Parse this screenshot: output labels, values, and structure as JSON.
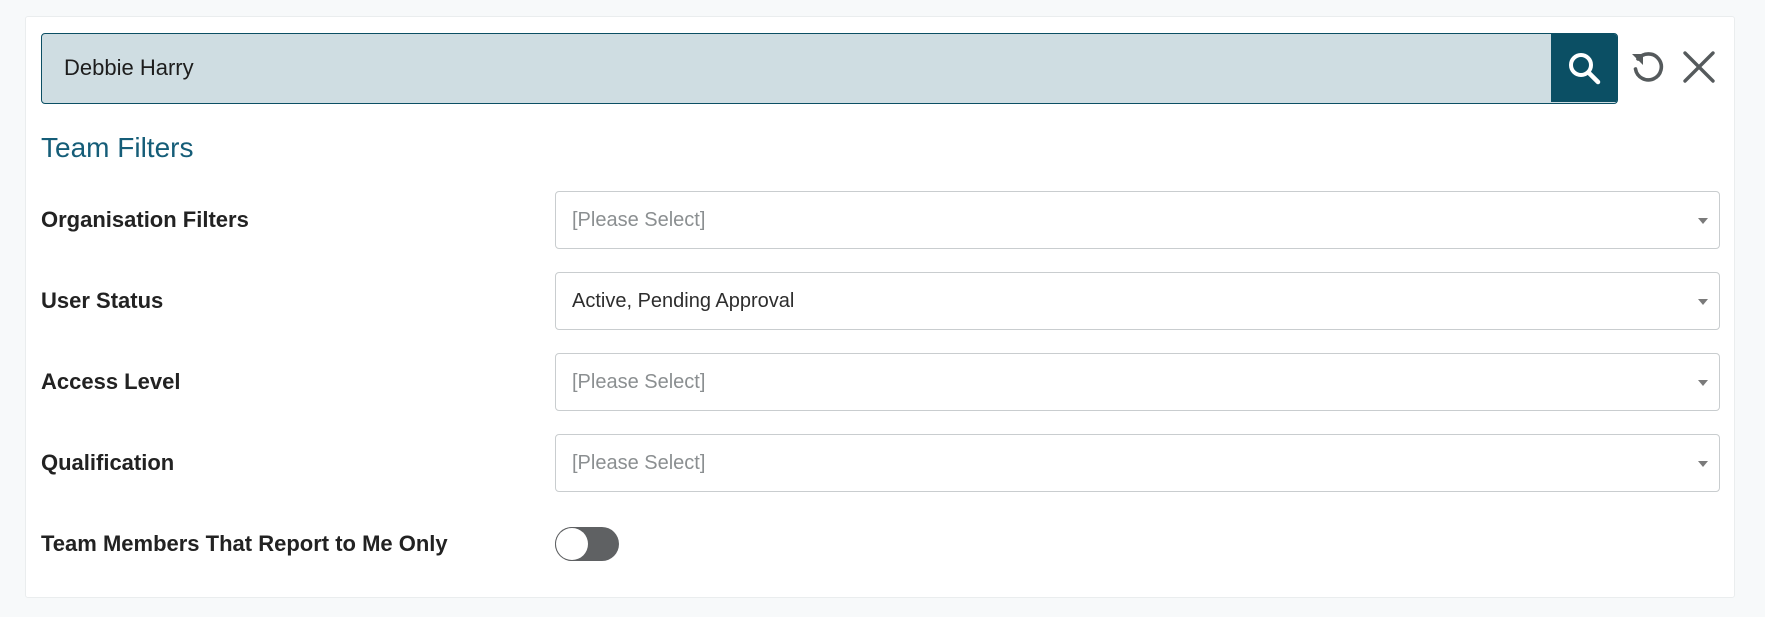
{
  "search": {
    "value": "Debbie Harry",
    "search_icon": "search-icon",
    "reset_icon": "refresh-icon",
    "close_icon": "close-icon"
  },
  "section_title": "Team Filters",
  "filters": [
    {
      "label": "Organisation Filters",
      "value": "[Please Select]",
      "is_placeholder": true
    },
    {
      "label": "User Status",
      "value": "Active, Pending Approval",
      "is_placeholder": false
    },
    {
      "label": "Access Level",
      "value": "[Please Select]",
      "is_placeholder": true
    },
    {
      "label": "Qualification",
      "value": "[Please Select]",
      "is_placeholder": true
    }
  ],
  "toggle": {
    "label": "Team Members That Report to Me Only",
    "checked": false
  },
  "colors": {
    "accent": "#0b4f64",
    "title": "#155d78",
    "search_bg": "#cfdde2",
    "toggle_off": "#5f6163"
  }
}
